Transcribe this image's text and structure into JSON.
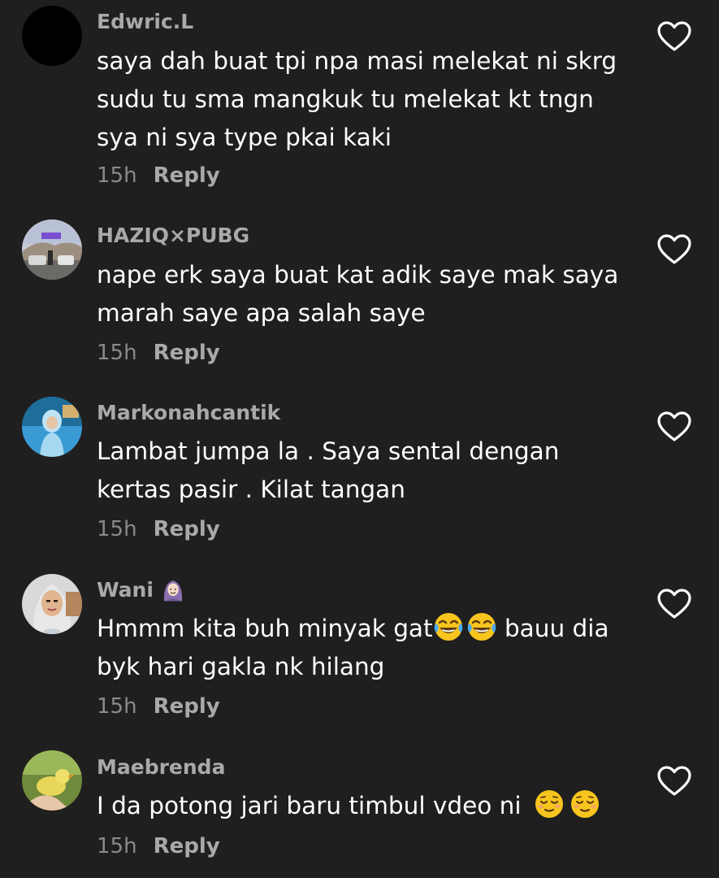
{
  "colors": {
    "background": "#1f1f1f",
    "username": "#a9a9a9",
    "text": "#ffffff",
    "time": "#8a8a8a",
    "reply": "#a9a9a9"
  },
  "comments": [
    {
      "username": "Edwric.L",
      "lines": [
        "saya dah buat tpi npa masi melekat ni skrg",
        "sudu tu sma mangkuk tu melekat kt tngn",
        "sya ni sya type pkai kaki"
      ],
      "time": "15h",
      "reply": "Reply"
    },
    {
      "username": "HAZIQ⨯PUBG",
      "lines": [
        "nape erk saya buat kat adik saye mak saya",
        "marah saye apa salah saye"
      ],
      "time": "15h",
      "reply": "Reply"
    },
    {
      "username": "Markonahcantik",
      "lines": [
        "Lambat jumpa la . Saya sental dengan",
        "kertas pasir . Kilat tangan"
      ],
      "time": "15h",
      "reply": "Reply"
    },
    {
      "username": "Wani",
      "lines": [
        "Hmmm kita buh minyak gat",
        "bauu dia",
        "byk hari gakla nk hilang"
      ],
      "time": "15h",
      "reply": "Reply"
    },
    {
      "username": "Maebrenda",
      "lines": [
        "I da potong jari baru timbul vdeo ni"
      ],
      "time": "15h",
      "reply": "Reply"
    }
  ]
}
